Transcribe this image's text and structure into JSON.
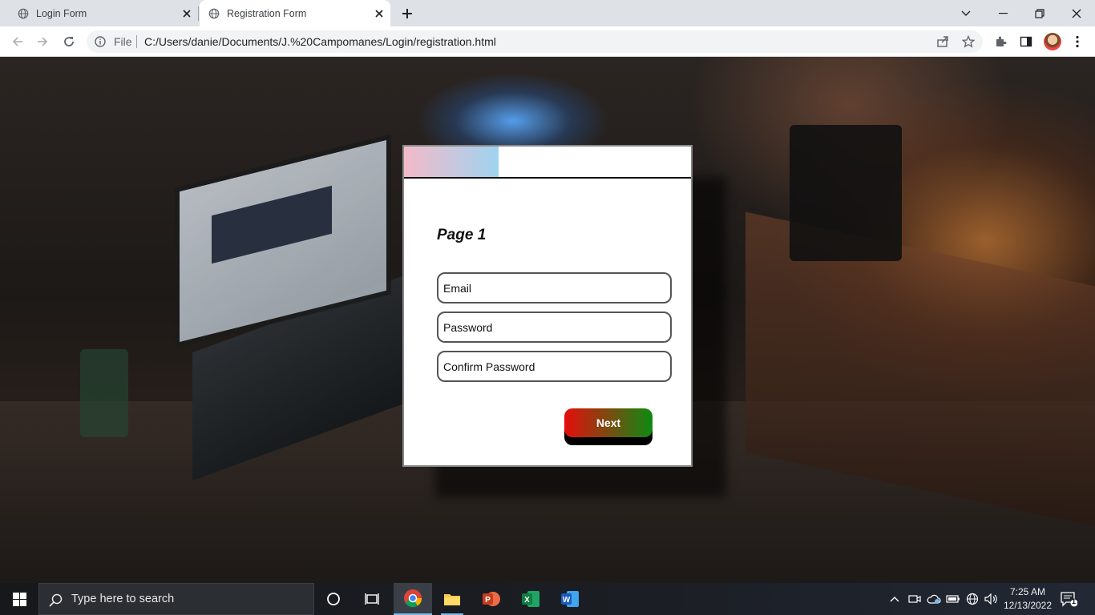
{
  "browser": {
    "tabs": [
      {
        "title": "Login Form",
        "active": false
      },
      {
        "title": "Registration Form",
        "active": true
      }
    ],
    "address": {
      "scheme_label": "File",
      "url": "C:/Users/danie/Documents/J.%20Campomanes/Login/registration.html"
    }
  },
  "form": {
    "page_title": "Page 1",
    "progress_fraction": 0.33,
    "fields": {
      "email_placeholder": "Email",
      "password_placeholder": "Password",
      "confirm_placeholder": "Confirm Password"
    },
    "next_label": "Next",
    "colors": {
      "progress_start": "#f4bac9",
      "progress_end": "#9fd3f0",
      "button_start": "#e60d0d",
      "button_end": "#0e8a12"
    }
  },
  "taskbar": {
    "search_placeholder": "Type here to search",
    "apps": [
      "chrome-icon",
      "file-explorer-icon",
      "powerpoint-icon",
      "excel-icon",
      "word-icon"
    ],
    "clock": {
      "time": "7:25 AM",
      "date": "12/13/2022"
    },
    "notification_count": "1"
  }
}
